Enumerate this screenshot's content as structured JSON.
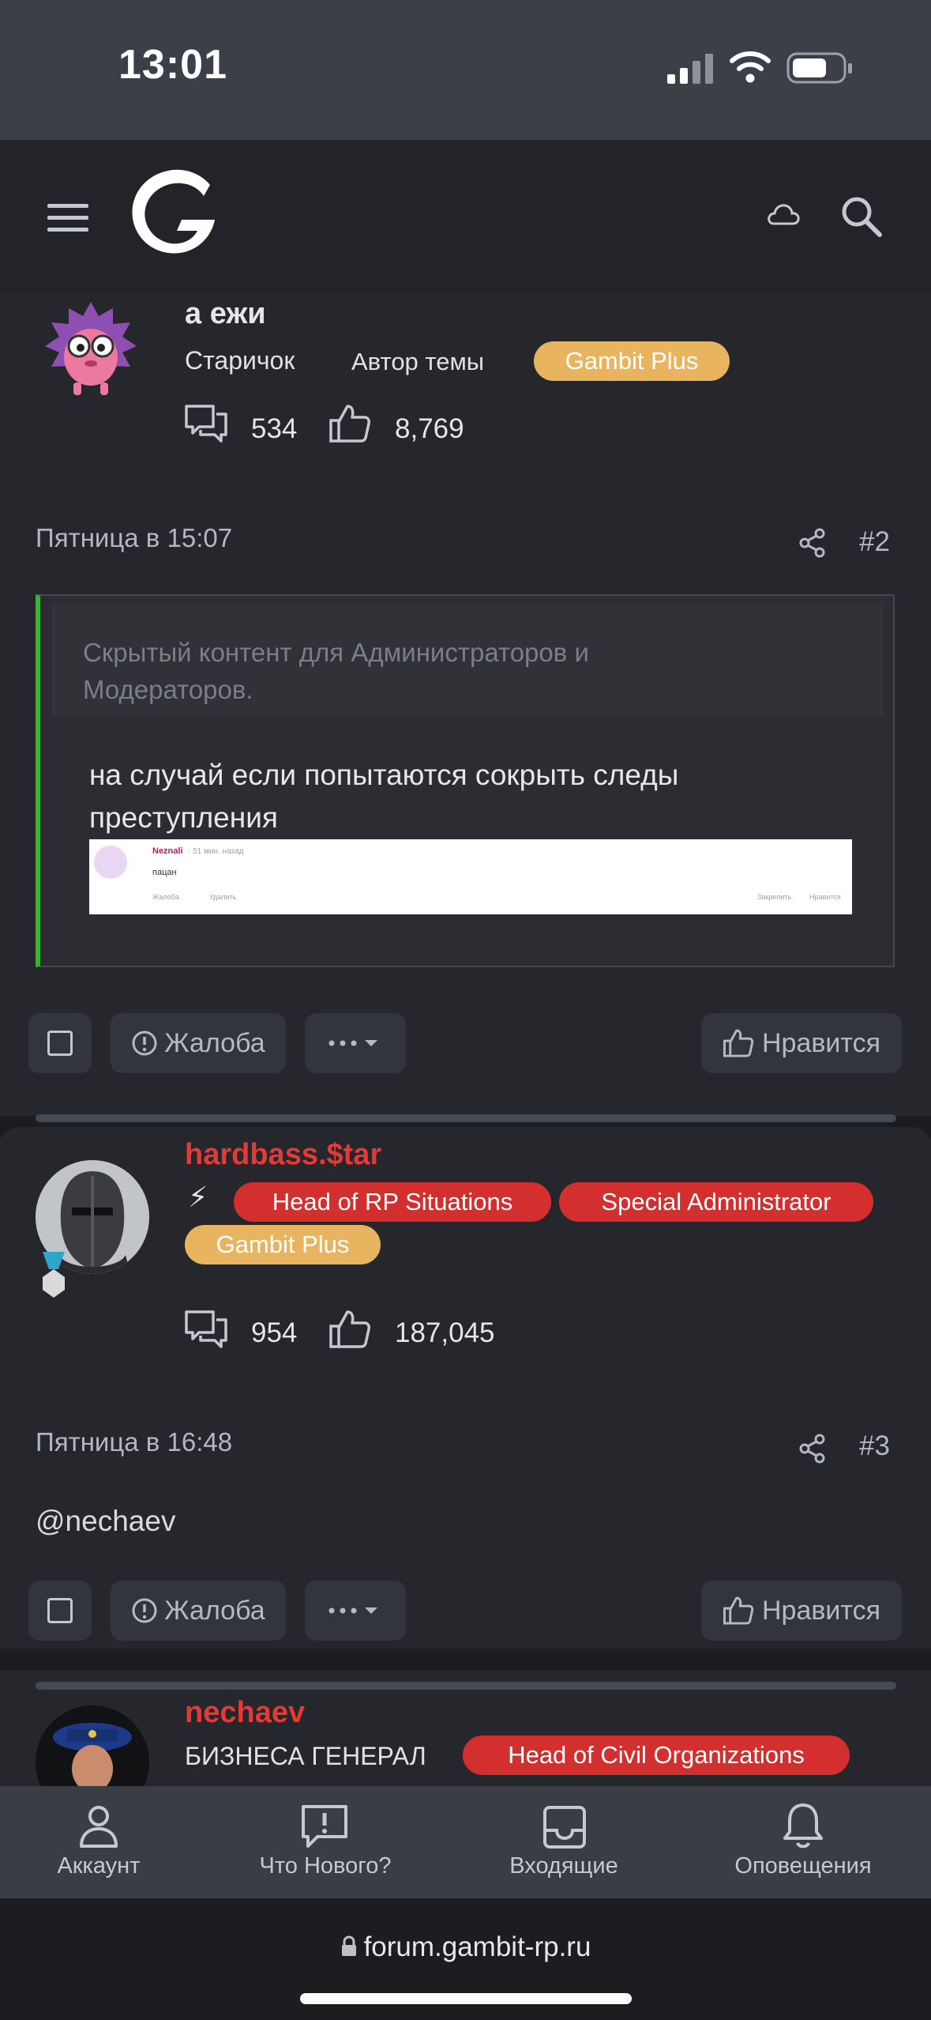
{
  "status_bar": {
    "time": "13:01"
  },
  "header": {
    "logo": "gambit-logo",
    "icons": [
      "menu-icon",
      "cloud-icon",
      "search-icon"
    ]
  },
  "posts": [
    {
      "username": "а ежи",
      "user_role": "Старичок",
      "author_label": "Автор темы",
      "badges": [
        "Gambit Plus"
      ],
      "messages_count": "534",
      "likes_count": "8,769",
      "date": "Пятница в 15:07",
      "number": "#2",
      "hidden_notice": "Скрытый контент для Администраторов и Модераторов.",
      "body": "на случай если попытаются сокрыть следы преступления",
      "screenshot": {
        "name": "Neznali",
        "time": "· 51 мин. назад",
        "text": "пацан",
        "report": "Жалоба",
        "delete": "Удалить",
        "pin": "Закрепить",
        "like": "Нравится"
      },
      "report_label": "Жалоба",
      "like_label": "Нравится"
    },
    {
      "username": "hardbass.$tar",
      "badges": [
        "Head of RP Situations",
        "Special Administrator",
        "Gambit Plus"
      ],
      "messages_count": "954",
      "likes_count": "187,045",
      "date": "Пятница в 16:48",
      "number": "#3",
      "body": "@nechaev",
      "report_label": "Жалоба",
      "like_label": "Нравится"
    },
    {
      "username": "nechaev",
      "user_role": "БИЗНЕСА ГЕНЕРАЛ",
      "badges": [
        "Head of Civil Organizations"
      ]
    }
  ],
  "bottom_nav": [
    {
      "label": "Аккаунт",
      "icon": "account-icon"
    },
    {
      "label": "Что Нового?",
      "icon": "whats-new-icon"
    },
    {
      "label": "Входящие",
      "icon": "inbox-icon"
    },
    {
      "label": "Оповещения",
      "icon": "bell-icon"
    }
  ],
  "url": "forum.gambit-rp.ru",
  "colors": {
    "accent_red": "#d32f2f",
    "accent_gold": "#e8b460",
    "username_red": "#e53935"
  }
}
